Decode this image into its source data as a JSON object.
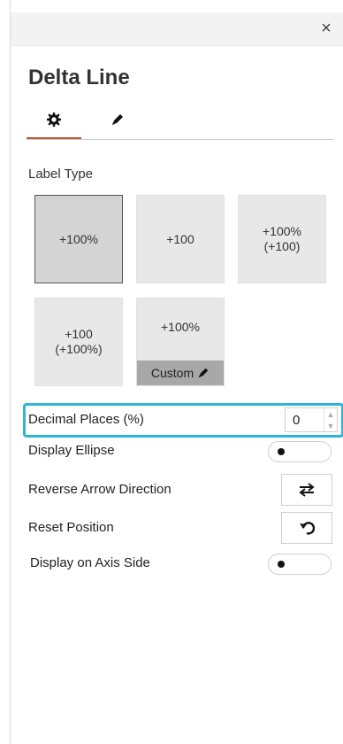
{
  "panel": {
    "close_label": "×",
    "title": "Delta Line",
    "tabs": [
      {
        "icon": "gear-icon"
      },
      {
        "icon": "pencil-icon"
      }
    ]
  },
  "label_type": {
    "heading": "Label Type",
    "options": [
      {
        "line1": "+100%",
        "line2": "",
        "selected": true
      },
      {
        "line1": "+100",
        "line2": "",
        "selected": false
      },
      {
        "line1": "+100%",
        "line2": "(+100)",
        "selected": false
      },
      {
        "line1": "+100",
        "line2": "(+100%)",
        "selected": false
      },
      {
        "line1": "+100%",
        "line2": "",
        "custom_label": "Custom",
        "selected": false
      }
    ]
  },
  "settings": {
    "decimal_places_label": "Decimal Places (%)",
    "decimal_places_value": "0",
    "display_ellipse_label": "Display Ellipse",
    "reverse_arrow_label": "Reverse Arrow Direction",
    "reset_position_label": "Reset Position",
    "display_axis_side_label": "Display on Axis Side"
  },
  "colors": {
    "accent_tab": "#c0502d",
    "highlight": "#2cb6d6"
  }
}
